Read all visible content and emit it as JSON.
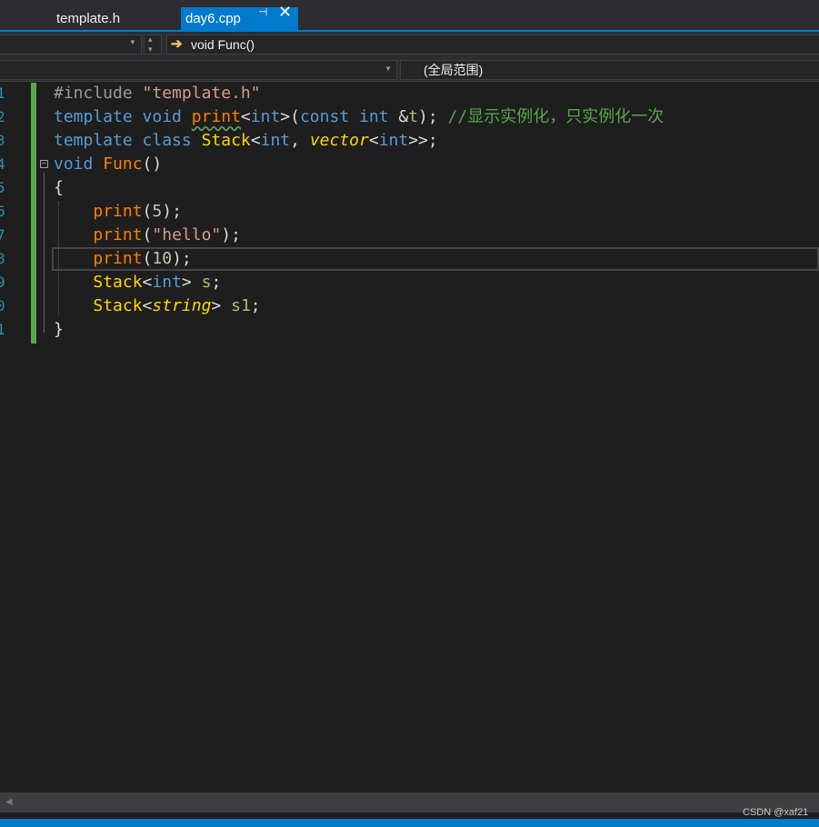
{
  "tabs": [
    {
      "label": "template.h",
      "active": false
    },
    {
      "label": "day6.cpp",
      "active": true
    }
  ],
  "nav": {
    "function_label": "void Func()",
    "scope_label": "(全局范围)"
  },
  "editor": {
    "line_numbers": [
      "1",
      "2",
      "3",
      "4",
      "5",
      "6",
      "7",
      "8",
      "9",
      "0",
      "1"
    ],
    "lines": [
      [
        {
          "t": "#include ",
          "c": "pp"
        },
        {
          "t": "\"template.h\"",
          "c": "str"
        }
      ],
      [
        {
          "t": "template ",
          "c": "kw"
        },
        {
          "t": "void ",
          "c": "kw"
        },
        {
          "t": "print",
          "c": "fn squig"
        },
        {
          "t": "<",
          "c": ""
        },
        {
          "t": "int",
          "c": "kw"
        },
        {
          "t": ">(",
          "c": ""
        },
        {
          "t": "const ",
          "c": "kw"
        },
        {
          "t": "int ",
          "c": "kw"
        },
        {
          "t": "&",
          "c": ""
        },
        {
          "t": "t",
          "c": "var"
        },
        {
          "t": "); ",
          "c": ""
        },
        {
          "t": "//显示实例化，只实例化一次",
          "c": "cm"
        }
      ],
      [
        {
          "t": "template ",
          "c": "kw"
        },
        {
          "t": "class ",
          "c": "kw"
        },
        {
          "t": "Stack",
          "c": "ty"
        },
        {
          "t": "<",
          "c": ""
        },
        {
          "t": "int",
          "c": "kw"
        },
        {
          "t": ", ",
          "c": ""
        },
        {
          "t": "vector",
          "c": "tyi"
        },
        {
          "t": "<",
          "c": ""
        },
        {
          "t": "int",
          "c": "kw"
        },
        {
          "t": ">>;",
          "c": ""
        }
      ],
      [
        {
          "t": "void ",
          "c": "kw"
        },
        {
          "t": "Func",
          "c": "fn"
        },
        {
          "t": "()",
          "c": ""
        }
      ],
      [
        {
          "t": "{",
          "c": ""
        }
      ],
      [
        {
          "t": "    ",
          "c": ""
        },
        {
          "t": "print",
          "c": "fn"
        },
        {
          "t": "(",
          "c": ""
        },
        {
          "t": "5",
          "c": "num"
        },
        {
          "t": ");",
          "c": ""
        }
      ],
      [
        {
          "t": "    ",
          "c": ""
        },
        {
          "t": "print",
          "c": "fn"
        },
        {
          "t": "(",
          "c": ""
        },
        {
          "t": "\"hello\"",
          "c": "str"
        },
        {
          "t": ");",
          "c": ""
        }
      ],
      [
        {
          "t": "    ",
          "c": ""
        },
        {
          "t": "print",
          "c": "fn"
        },
        {
          "t": "(",
          "c": ""
        },
        {
          "t": "10",
          "c": "num"
        },
        {
          "t": ");",
          "c": ""
        }
      ],
      [
        {
          "t": "    ",
          "c": ""
        },
        {
          "t": "Stack",
          "c": "ty"
        },
        {
          "t": "<",
          "c": ""
        },
        {
          "t": "int",
          "c": "kw"
        },
        {
          "t": "> ",
          "c": ""
        },
        {
          "t": "s",
          "c": "var"
        },
        {
          "t": ";",
          "c": ""
        }
      ],
      [
        {
          "t": "    ",
          "c": ""
        },
        {
          "t": "Stack",
          "c": "ty"
        },
        {
          "t": "<",
          "c": ""
        },
        {
          "t": "string",
          "c": "tyi"
        },
        {
          "t": "> ",
          "c": ""
        },
        {
          "t": "s1",
          "c": "var"
        },
        {
          "t": ";",
          "c": ""
        }
      ],
      [
        {
          "t": "}",
          "c": ""
        }
      ]
    ]
  },
  "icons": {
    "pin": "⊣",
    "close": "✕",
    "func_arrow": "➔",
    "collapse": "−",
    "dropdown": "▼",
    "spin_up": "▴",
    "spin_down": "▾",
    "scroll_left": "◀"
  },
  "watermark": "CSDN @xaf21",
  "colors": {
    "accent": "#007acc",
    "background": "#1e1e1e",
    "keyword": "#569cd6",
    "function": "#ff8000",
    "type": "#ffd700",
    "string": "#d69d85",
    "comment": "#57a64a",
    "number": "#b5cea8",
    "line_number": "#2b91af"
  }
}
